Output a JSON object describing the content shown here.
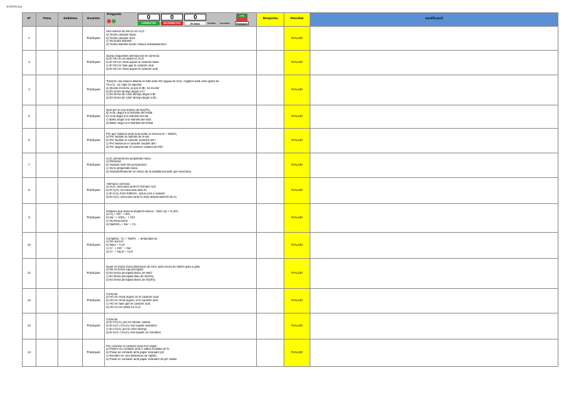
{
  "sheet_label": "BTEPELEA",
  "headers": {
    "num": "Nº",
    "tema": "Tema",
    "subtema": "Subtema",
    "examen": "Examen",
    "pregunta": "Pregunta",
    "resposta": "Resposta",
    "resultat": "Resultat",
    "justificacio": "Justificació"
  },
  "score_widget": {
    "correct_count": "0",
    "incorrect_count": "0",
    "blank_count": "0",
    "correct_label": "CORRECTES",
    "incorrect_label": "INCORRECTES",
    "blank_label": "En blanc",
    "pct_label": "%Totales",
    "approved_label": "Aprovades",
    "mark_top": "1,00",
    "points_label": "Puntuació"
  },
  "rows": [
    {
      "num": "2",
      "exam": "Pràctiques",
      "result": "#VALUE!",
      "lines": [
        "Una solució de NH₄Cl en H₂O :",
        "a) Tindrà caràcter bàsic",
        "b) Tindrà caràcter àcid",
        "c) No tindrà hidròlisi",
        "d) Tindrà hidròlisi àcida i bàsica simultàniament"
      ]
    },
    {
      "num": "3",
      "exam": "Pràctiques",
      "result": "#VALUE!",
      "lines": [
        "Quina d'aquestes afirmacions és correcta:",
        "a) El HCl no es dissol en H₂O",
        "b) El HCl en medi aquós té caràcter bàsic",
        "c) El HCl en fase gas té caràcter àcid",
        "d) El HCl en medi aquós té caràcter àcid"
      ]
    },
    {
      "num": "4",
      "exam": "Pràctiques",
      "result": "#VALUE!",
      "lines": [
        "Tractem una solució diluïda en KBr amb HCl (aigua de clor) i l'agitem amb unes gotes de",
        "CH₂Cl₂. La capa no aquosa:",
        "a) Queda incolora, ja que el Br₂ és incolor",
        "b) Es forma taronja degut a Cl",
        "c) Es forma de color taronja degut a Br",
        "d) Es forma de color taronja degut a Br₂"
      ]
    },
    {
      "num": "5",
      "exam": "Pràctiques",
      "result": "#VALUE!",
      "lines": [
        "Quin pH té una solució de Na₃PO₄",
        "a) Àcid, degut a la hidròlisi del fosfat",
        "b) Àcid degut a la hidròlisi del sal",
        "c) Bàsic degut a la hidròlisi del sodi",
        "d) Bàsic degut a la hidròlisi del fosfat"
      ]
    },
    {
      "num": "6",
      "exam": "Pràctiques",
      "result": "#VALUE!",
      "lines": [
        "Per què l'addició amb àcid acètic la reacció KI + NaNO₂",
        "a) Per facilitar la hidròlisi de la sal",
        "b) Per facilitar el caràcter reductor del I",
        "c) Per disminuir el caràcter oxidant del I",
        "d) Per augmentar el caràcter oxidant del NO⁻"
      ]
    },
    {
      "num": "7",
      "exam": "Pràctiques",
      "result": "#VALUE!",
      "lines": [
        "H₂O₂ presenta les propietats redox:",
        "a) Reductor",
        "b) Oxidant molt fort (únicament)",
        "c) No té propietats redox",
        "d) Oxidant/Reductor en funció de la substància amb que reacciona"
      ]
    },
    {
      "num": "8",
      "exam": "Pràctiques",
      "result": "#VALUE!",
      "lines": [
        "Afirmació correcta:",
        "a) H₂O₂ reacciona amb KI formant H₂O",
        "b) El H₂O₂ no reacciona amb KI",
        "c) El H₂O₂ front KMnO4-, actua com a oxidant",
        "d) El H₂O₂ reacciona amb KI amb desprendiment de O₂"
      ]
    },
    {
      "num": "9",
      "exam": "Pràctiques",
      "result": "#VALUE!",
      "lines": [
        "Indiques que dona la següent reacció : NaCl (s) + H₂SO₄",
        "a) Cl₂ + Na⁺ + SO₄",
        "b) Na⁺ + HSO₄⁻ + HCl",
        "c) No Reacciona",
        "d) NaHSO₄ + Na⁺ + Cl₂"
      ]
    },
    {
      "num": "10",
      "exam": "Pràctiques",
      "result": "#VALUE!",
      "lines": [
        "Completa : Cl₂ + NaOH → desproporció",
        "a) No reacció",
        "b) NaCl + H₂O",
        "c) Cl⁻ + ClO⁻ + Na⁺",
        "d) Cl⁻ + Na₂O + H₂O"
      ]
    },
    {
      "num": "11",
      "exam": "Pràctiques",
      "result": "#VALUE!",
      "lines": [
        "Quan es tracta d'una dissolució de AlCl₃ amb excés de NaOH gota a gota",
        "a) No es forma cap precipitat",
        "b) Es forma precipitat blanc de NaCl",
        "c) Es forma precipitat blau de Al(OH)₃",
        "d) Es forma precipitat blanc de Al(OH)₃"
      ]
    },
    {
      "num": "12",
      "exam": "Pràctiques",
      "result": "#VALUE!",
      "lines": [
        "Correcta:",
        "a) HCl en medi aquós no té caràcter àcid",
        "b) HCl en medi aquós, si té caràcter àcid",
        "c) HCl en fase gas té caràcter àcid",
        "d) HCl no es dissol en H₂O"
      ]
    },
    {
      "num": "13",
      "exam": "Pràctiques",
      "result": "#VALUE!",
      "lines": [
        "Correcta:",
        "a) El CH₂Cl₂ pur és colorat: violeta",
        "b) El H₂O i CH₂Cl₂ són líquids miscibles",
        "c) El CH₂Cl₂ pur té color taronja",
        "d) El H₂O i CH₂Cl₂ són líquids no miscibles"
      ]
    },
    {
      "num": "14",
      "exam": "Pràctiques",
      "result": "#VALUE!",
      "lines": [
        "Per conèixer el caràcter àcid d'un vapor:",
        "a) Posem en contacte amb 1 valeta mullada de N",
        "b) Posar de contacte amb paper indicador pH",
        "c) Recollim en una dissolució de AgNO₃",
        "d) Posar en contacte amb paper indicador de pH mullat"
      ]
    }
  ]
}
